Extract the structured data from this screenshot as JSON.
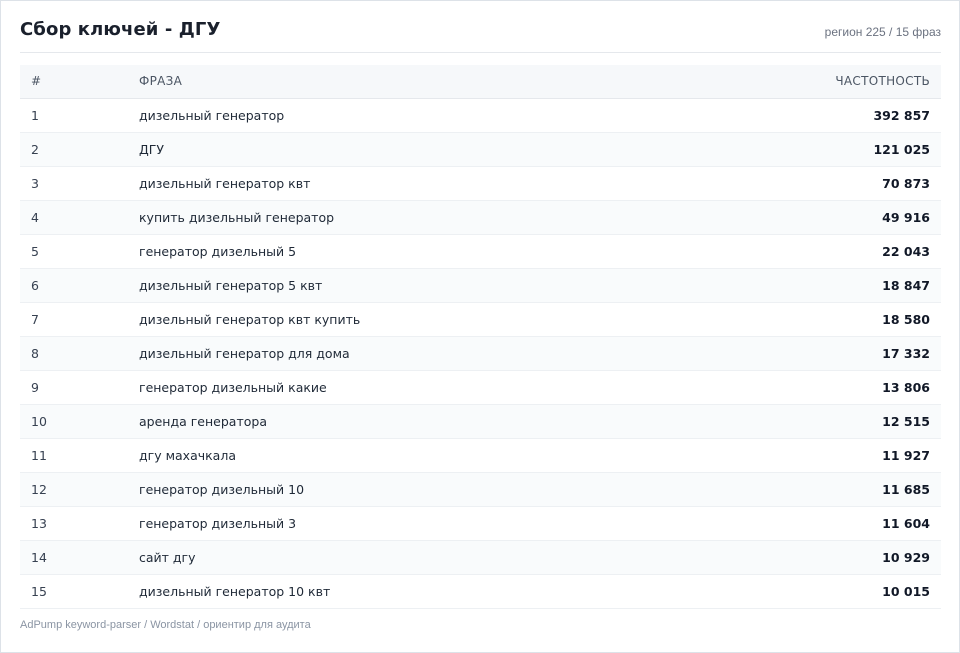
{
  "header": {
    "title": "Сбор ключей - ДГУ",
    "meta": "регион 225 / 15 фраз"
  },
  "table": {
    "columns": {
      "num": "#",
      "phrase": "ФРАЗА",
      "frequency": "ЧАСТОТНОСТЬ"
    },
    "rows": [
      {
        "num": "1",
        "phrase": "дизельный генератор",
        "frequency": "392 857"
      },
      {
        "num": "2",
        "phrase": "ДГУ",
        "frequency": "121 025"
      },
      {
        "num": "3",
        "phrase": "дизельный генератор квт",
        "frequency": "70 873"
      },
      {
        "num": "4",
        "phrase": "купить дизельный генератор",
        "frequency": "49 916"
      },
      {
        "num": "5",
        "phrase": "генератор дизельный 5",
        "frequency": "22 043"
      },
      {
        "num": "6",
        "phrase": "дизельный генератор 5 квт",
        "frequency": "18 847"
      },
      {
        "num": "7",
        "phrase": "дизельный генератор квт купить",
        "frequency": "18 580"
      },
      {
        "num": "8",
        "phrase": "дизельный генератор для дома",
        "frequency": "17 332"
      },
      {
        "num": "9",
        "phrase": "генератор дизельный какие",
        "frequency": "13 806"
      },
      {
        "num": "10",
        "phrase": "аренда генератора",
        "frequency": "12 515"
      },
      {
        "num": "11",
        "phrase": "дгу махачкала",
        "frequency": "11 927"
      },
      {
        "num": "12",
        "phrase": "генератор дизельный 10",
        "frequency": "11 685"
      },
      {
        "num": "13",
        "phrase": "генератор дизельный 3",
        "frequency": "11 604"
      },
      {
        "num": "14",
        "phrase": "сайт дгу",
        "frequency": "10 929"
      },
      {
        "num": "15",
        "phrase": "дизельный генератор 10 квт",
        "frequency": "10 015"
      }
    ]
  },
  "footer": {
    "note": "AdPump keyword-parser / Wordstat / ориентир для аудита"
  }
}
